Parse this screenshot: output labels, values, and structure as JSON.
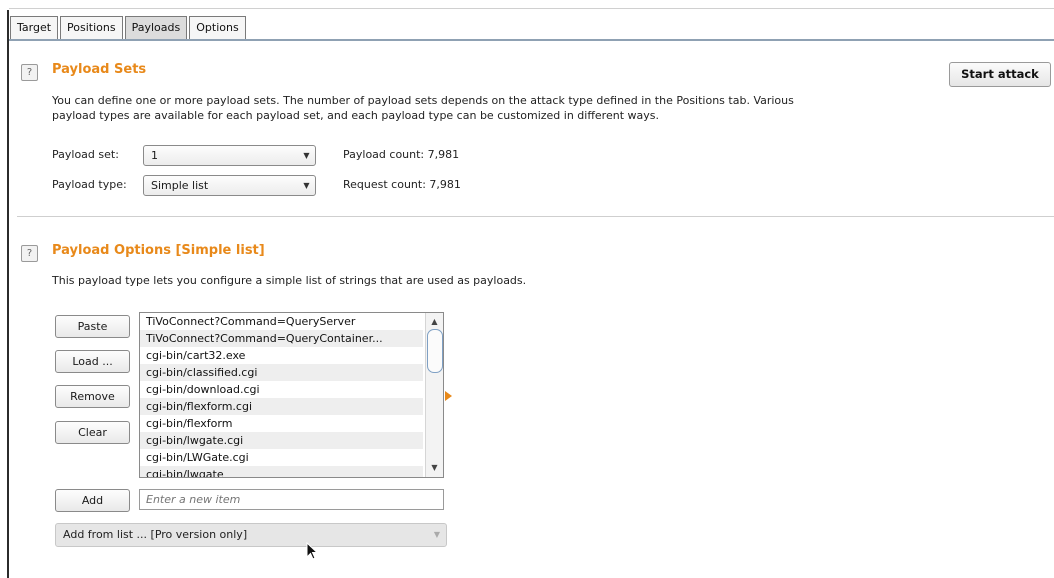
{
  "tabs": [
    {
      "label": "Target",
      "active": false
    },
    {
      "label": "Positions",
      "active": false
    },
    {
      "label": "Payloads",
      "active": true
    },
    {
      "label": "Options",
      "active": false
    }
  ],
  "payload_sets": {
    "help_icon": "?",
    "title": "Payload Sets",
    "description_line1": "You can define one or more payload sets. The number of payload sets depends on the attack type defined in the Positions tab. Various",
    "description_line2": "payload types are available for each payload set, and each payload type can be customized in different ways.",
    "start_attack_label": "Start attack",
    "payload_set_label": "Payload set:",
    "payload_set_value": "1",
    "payload_type_label": "Payload type:",
    "payload_type_value": "Simple list",
    "payload_count": "Payload count: 7,981",
    "request_count": "Request count: 7,981"
  },
  "payload_options": {
    "help_icon": "?",
    "title": "Payload Options [Simple list]",
    "description": "This payload type lets you configure a simple list of strings that are used as payloads.",
    "buttons": {
      "paste": "Paste",
      "load": "Load ...",
      "remove": "Remove",
      "clear": "Clear",
      "add": "Add"
    },
    "list_items": [
      "TiVoConnect?Command=QueryServer",
      "TiVoConnect?Command=QueryContainer...",
      "cgi-bin/cart32.exe",
      "cgi-bin/classified.cgi",
      "cgi-bin/download.cgi",
      "cgi-bin/flexform.cgi",
      "cgi-bin/flexform",
      "cgi-bin/lwgate.cgi",
      "cgi-bin/LWGate.cgi",
      "cgi-bin/lwgate"
    ],
    "new_item_placeholder": "Enter a new item",
    "add_from_list": "Add from list ... [Pro version only]"
  },
  "icons": {
    "dropdown_arrow": "▼",
    "scroll_up": "▲",
    "scroll_down": "▼",
    "expand_arrow": "orange-triangle-right"
  },
  "colors": {
    "accent": "#e8891a",
    "tab_underline": "#8fa1b3"
  }
}
